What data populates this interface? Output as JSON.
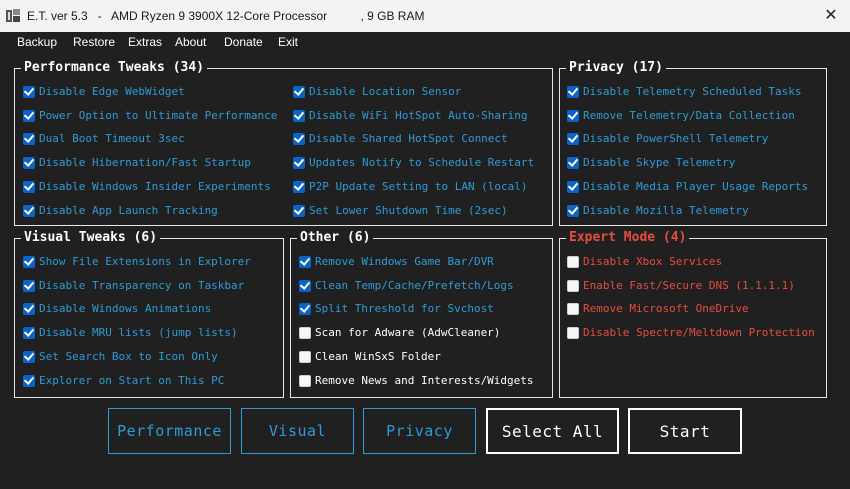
{
  "title": "E.T. ver 5.3   -   AMD Ryzen 9 3900X 12-Core Processor          , 9 GB RAM",
  "close_glyph": "✕",
  "menu": [
    "Backup",
    "Restore",
    "Extras",
    "About",
    "Donate",
    "Exit"
  ],
  "performance": {
    "title": "Performance Tweaks (34)",
    "col1": [
      {
        "label": "Disable Edge WebWidget",
        "checked": true
      },
      {
        "label": "Power Option to Ultimate Performance",
        "checked": true
      },
      {
        "label": "Dual Boot Timeout 3sec",
        "checked": true
      },
      {
        "label": "Disable Hibernation/Fast Startup",
        "checked": true
      },
      {
        "label": "Disable Windows Insider Experiments",
        "checked": true
      },
      {
        "label": "Disable App Launch Tracking",
        "checked": true
      }
    ],
    "col2": [
      {
        "label": "Disable Location Sensor",
        "checked": true
      },
      {
        "label": "Disable WiFi HotSpot Auto-Sharing",
        "checked": true
      },
      {
        "label": "Disable Shared HotSpot Connect",
        "checked": true
      },
      {
        "label": "Updates Notify to Schedule Restart",
        "checked": true
      },
      {
        "label": "P2P Update Setting to LAN (local)",
        "checked": true
      },
      {
        "label": "Set Lower Shutdown Time (2sec)",
        "checked": true
      }
    ]
  },
  "privacy": {
    "title": "Privacy (17)",
    "items": [
      {
        "label": "Disable Telemetry Scheduled Tasks",
        "checked": true
      },
      {
        "label": "Remove Telemetry/Data Collection",
        "checked": true
      },
      {
        "label": "Disable PowerShell Telemetry",
        "checked": true
      },
      {
        "label": "Disable Skype Telemetry",
        "checked": true
      },
      {
        "label": "Disable Media Player Usage Reports",
        "checked": true
      },
      {
        "label": "Disable Mozilla Telemetry",
        "checked": true
      }
    ]
  },
  "visual": {
    "title": "Visual Tweaks (6)",
    "items": [
      {
        "label": "Show File Extensions in Explorer",
        "checked": true
      },
      {
        "label": "Disable Transparency on Taskbar",
        "checked": true
      },
      {
        "label": "Disable Windows Animations",
        "checked": true
      },
      {
        "label": "Disable MRU lists (jump lists)",
        "checked": true
      },
      {
        "label": "Set Search Box to Icon Only",
        "checked": true
      },
      {
        "label": "Explorer on Start on This PC",
        "checked": true
      }
    ]
  },
  "other": {
    "title": "Other (6)",
    "items": [
      {
        "label": "Remove Windows Game Bar/DVR",
        "checked": true
      },
      {
        "label": "Clean Temp/Cache/Prefetch/Logs",
        "checked": true
      },
      {
        "label": "Split Threshold for Svchost",
        "checked": true
      },
      {
        "label": "Scan for Adware (AdwCleaner)",
        "checked": false
      },
      {
        "label": "Clean WinSxS Folder",
        "checked": false
      },
      {
        "label": "Remove News and Interests/Widgets",
        "checked": false
      }
    ]
  },
  "expert": {
    "title": "Expert Mode (4)",
    "items": [
      {
        "label": "Disable Xbox Services",
        "checked": false
      },
      {
        "label": "Enable Fast/Secure DNS (1.1.1.1)",
        "checked": false
      },
      {
        "label": "Remove Microsoft OneDrive",
        "checked": false
      },
      {
        "label": "Disable Spectre/Meltdown Protection",
        "checked": false
      }
    ]
  },
  "buttons": {
    "performance": "Performance",
    "visual": "Visual",
    "privacy": "Privacy",
    "select_all": "Select All",
    "start": "Start"
  },
  "colors": {
    "background": "#202020",
    "accent_blue": "#2e9bd6",
    "expert_red": "#e74c3c",
    "checkbox_blue": "#0a64c8"
  }
}
